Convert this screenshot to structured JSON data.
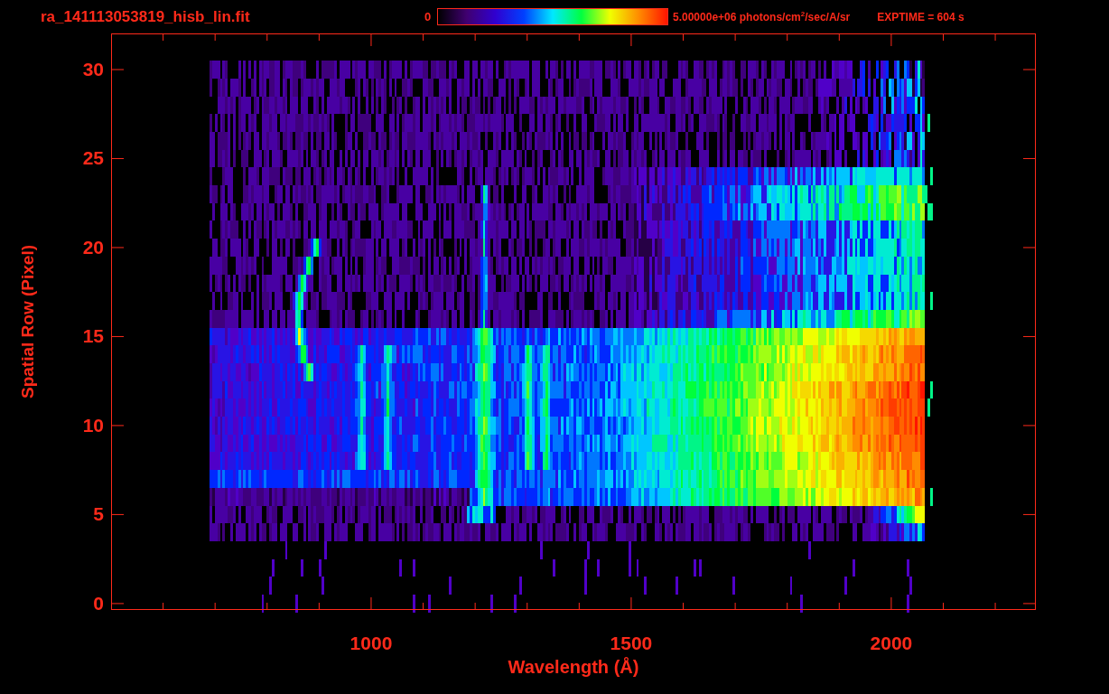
{
  "title": "ra_141113053819_hisb_lin.fit",
  "colorbar": {
    "min_label": "0",
    "max_label": "5.00000e+06 photons/cm$^{2}$/sec/A/sr"
  },
  "exptime": "EXPTIME = 604 s",
  "plot": {
    "xlabel": "Wavelength (Å)",
    "ylabel": "Spatial Row (Pixel)",
    "xtick_labels": [
      "1000",
      "1500",
      "2000"
    ],
    "ytick_labels": [
      "30",
      "25",
      "20",
      "15",
      "10",
      "5",
      "0"
    ]
  }
}
